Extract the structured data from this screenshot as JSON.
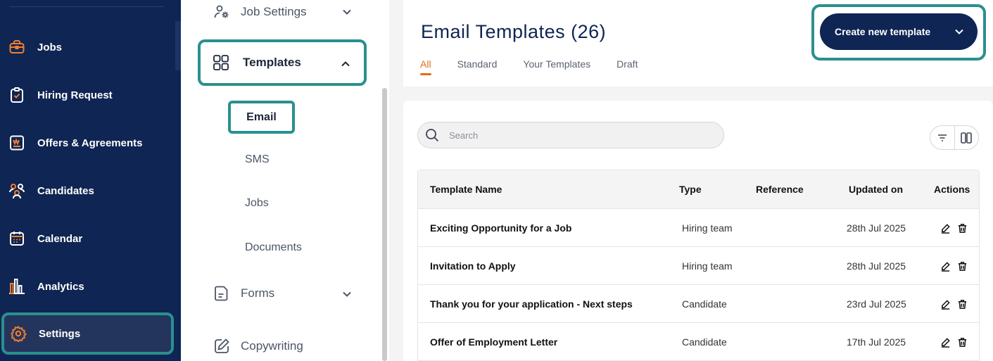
{
  "sidebar": {
    "items": [
      {
        "label": "Jobs",
        "icon": "briefcase-icon"
      },
      {
        "label": "Hiring Request",
        "icon": "clipboard-check-icon"
      },
      {
        "label": "Offers & Agreements",
        "icon": "document-signature-icon"
      },
      {
        "label": "Candidates",
        "icon": "people-icon"
      },
      {
        "label": "Calendar",
        "icon": "calendar-icon"
      },
      {
        "label": "Analytics",
        "icon": "bar-chart-icon"
      },
      {
        "label": "Settings",
        "icon": "gear-icon",
        "active": true
      }
    ]
  },
  "submenu": {
    "job_settings": "Job Settings",
    "templates": "Templates",
    "template_children": [
      "Email",
      "SMS",
      "Jobs",
      "Documents"
    ],
    "forms": "Forms",
    "copywriting": "Copywriting"
  },
  "header": {
    "title": "Email Templates (26)",
    "tabs": [
      "All",
      "Standard",
      "Your Templates",
      "Draft"
    ],
    "active_tab": "All",
    "create_button": "Create new template"
  },
  "search": {
    "placeholder": "Search",
    "value": ""
  },
  "table": {
    "columns": [
      "Template Name",
      "Type",
      "Reference",
      "Updated on",
      "Actions"
    ],
    "rows": [
      {
        "name": "Exciting Opportunity for a Job",
        "type": "Hiring team",
        "reference": "",
        "updated": "28th Jul 2025"
      },
      {
        "name": "Invitation to Apply",
        "type": "Hiring team",
        "reference": "",
        "updated": "28th Jul 2025"
      },
      {
        "name": "Thank you for your application - Next steps",
        "type": "Candidate",
        "reference": "",
        "updated": "23rd Jul 2025"
      },
      {
        "name": "Offer of Employment Letter",
        "type": "Candidate",
        "reference": "",
        "updated": "17th Jul 2025"
      }
    ]
  },
  "colors": {
    "sidebar_bg": "#0f2553",
    "accent_orange": "#e36b1f",
    "highlight_teal": "#2b8f8f",
    "primary_button": "#0f2553"
  }
}
